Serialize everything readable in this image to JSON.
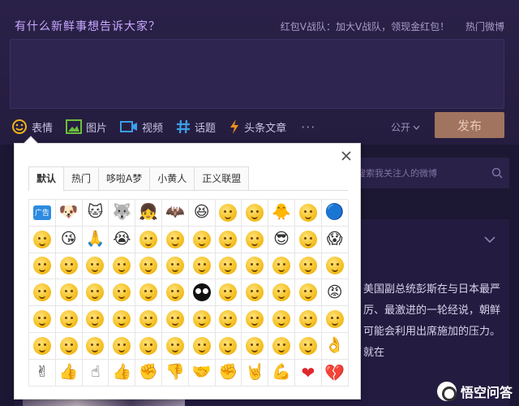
{
  "composer": {
    "slogan": "有什么新鲜事想告诉大家？",
    "promo_text": "红包V战队：加大V战队，领现金红包！",
    "hot_link": "热门微博",
    "tools": [
      {
        "label": "表情",
        "icon": "smiley-icon"
      },
      {
        "label": "图片",
        "icon": "image-icon"
      },
      {
        "label": "视频",
        "icon": "video-icon"
      },
      {
        "label": "话题",
        "icon": "hashtag-icon"
      },
      {
        "label": "头条文章",
        "icon": "lightning-icon"
      }
    ],
    "more": "···",
    "visibility": "公开",
    "publish_label": "发布"
  },
  "feed": {
    "search_placeholder": "搜索我关注人的微博",
    "text": "美国副总统彭斯在与日本最严厉、最激进的一轮经说，朝鲜可能会利用出席施加的压力。就在"
  },
  "emoji_panel": {
    "tabs": [
      "默认",
      "热门",
      "哆啦A梦",
      "小黄人",
      "正义联盟"
    ],
    "active_tab": "默认",
    "ad_label": "广告",
    "grid": [
      [
        "ad",
        "dog",
        "cat",
        "husky",
        "girl",
        "batman",
        "laugh",
        "smile",
        "smile",
        "chick",
        "smile",
        "doraemon"
      ],
      [
        "smile",
        "kiss",
        "pray",
        "cry",
        "smile",
        "smile",
        "smile",
        "smile",
        "smile",
        "cool",
        "smile",
        "yell"
      ],
      [
        "smile",
        "smile",
        "smile",
        "smile",
        "smile",
        "smile",
        "smile",
        "smile",
        "smile",
        "smile",
        "smile",
        "smile"
      ],
      [
        "smile",
        "smile",
        "smile",
        "smile",
        "smile",
        "smile",
        "dark",
        "smile",
        "smile",
        "smile",
        "smile",
        "angry"
      ],
      [
        "smile",
        "smile",
        "smile",
        "smile",
        "smile",
        "smile",
        "smile",
        "smile",
        "smile",
        "smile",
        "smile",
        "smile"
      ],
      [
        "smile",
        "smile",
        "smile",
        "smile",
        "smile",
        "smile",
        "smile",
        "smile",
        "smile",
        "smile",
        "smile",
        "ok"
      ],
      [
        "victory",
        "thumbs-up",
        "point",
        "thumbs-up",
        "fist",
        "thumbs-down",
        "handshake",
        "fist",
        "rock",
        "muscle",
        "heart",
        "broken-heart"
      ]
    ]
  },
  "watermark": "悟空问答"
}
